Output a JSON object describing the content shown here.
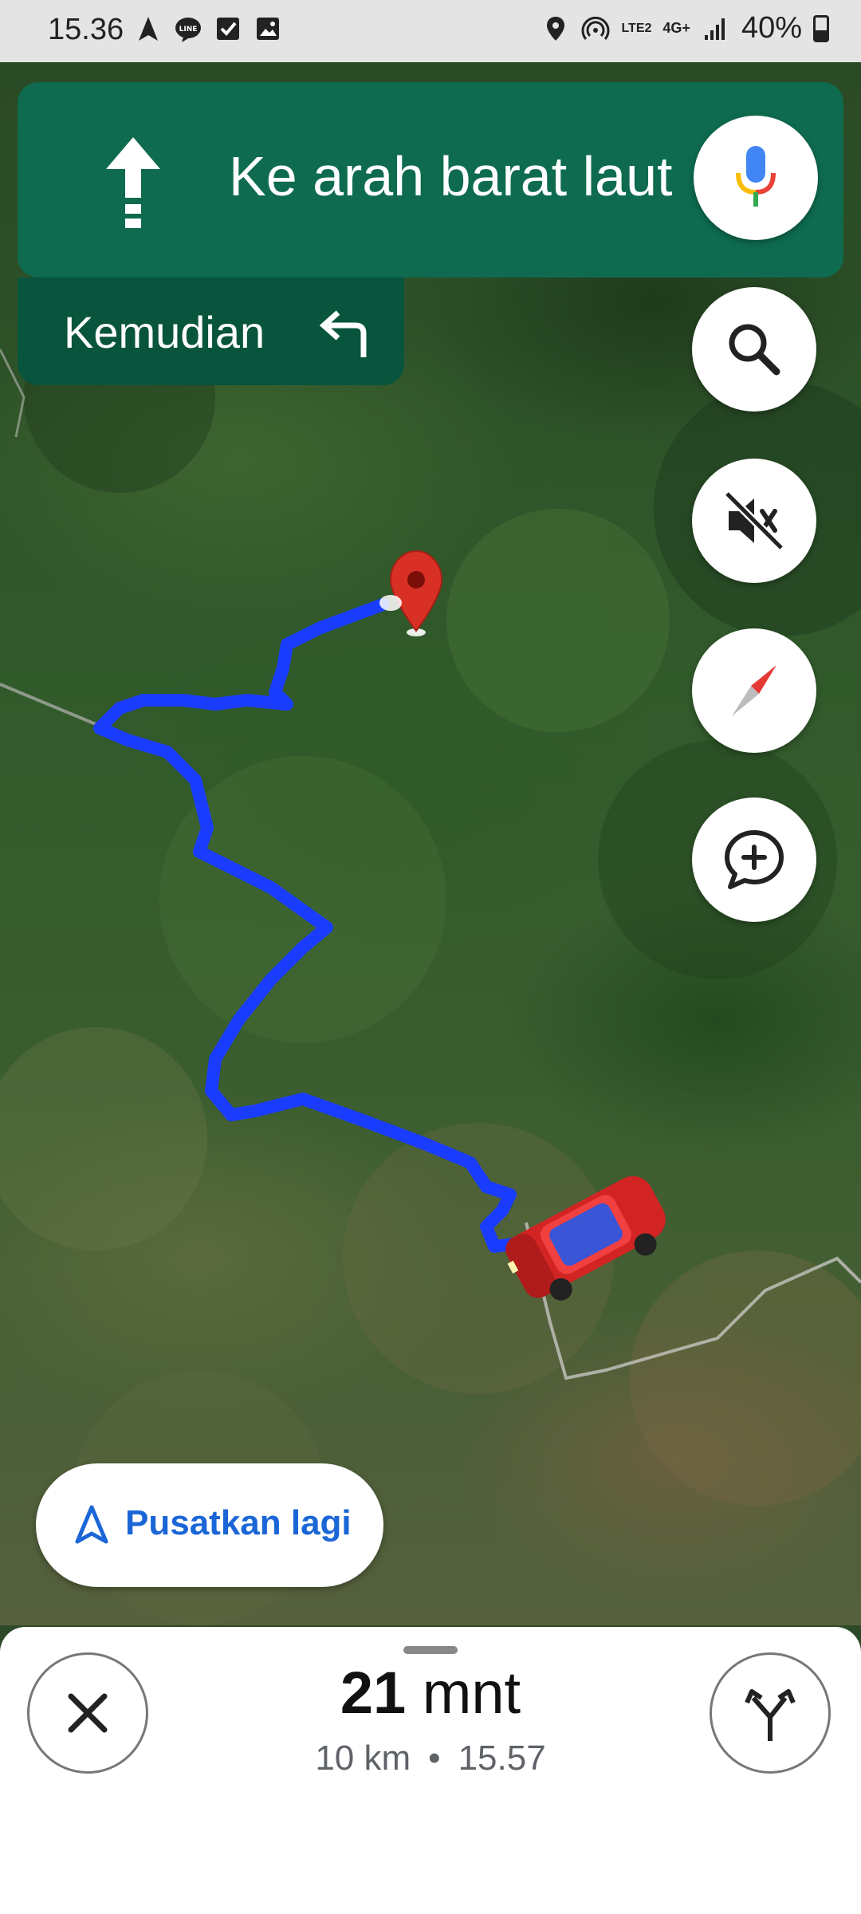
{
  "status_bar": {
    "time": "15.36",
    "battery": "40%",
    "network_label": "LTE2",
    "network_type": "4G+"
  },
  "navigation": {
    "instruction": "Ke arah barat laut",
    "then_label": "Kemudian"
  },
  "controls": {
    "mic_icon": "mic-icon",
    "search_icon": "search-icon",
    "mute_icon": "volume-off-icon",
    "compass_icon": "compass-icon",
    "report_icon": "add-comment-icon"
  },
  "recenter": {
    "label": "Pusatkan lagi"
  },
  "trip": {
    "duration_value": "21",
    "duration_unit": "mnt",
    "distance": "10 km",
    "separator": "•",
    "arrival_time": "15.57"
  },
  "colors": {
    "banner": "#0e6b4f",
    "banner_then": "#09543d",
    "route": "#1a3cff",
    "accent": "#1a66d6",
    "pin": "#d93025"
  }
}
